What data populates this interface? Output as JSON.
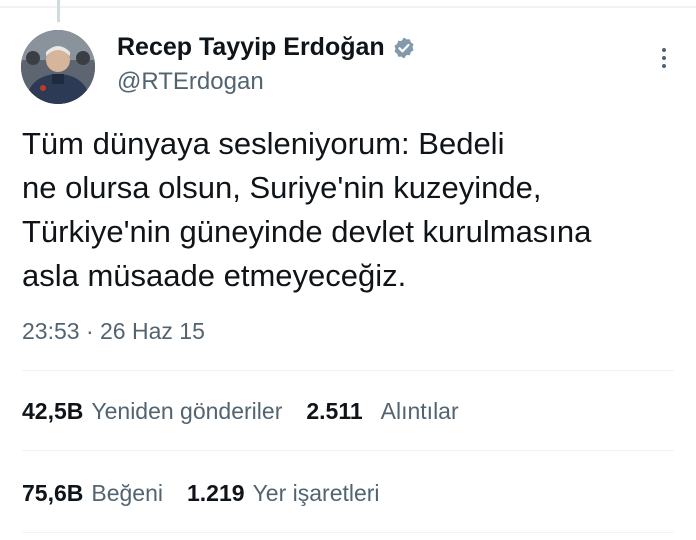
{
  "author": {
    "name": "Recep Tayyip Erdoğan",
    "handle": "@RTErdogan",
    "verified_badge_color": "#829aab"
  },
  "tweet": {
    "text": "Tüm dünyaya sesleniyorum: Bedeli\nne olursa olsun, Suriye'nin kuzeyinde,\nTürkiye'nin güneyinde devlet kurulmasına\nasla müsaade etmeyeceğiz.",
    "time": "23:53",
    "separator": "·",
    "date": "26 Haz 15"
  },
  "stats": {
    "reposts_count": "42,5B",
    "reposts_label": "Yeniden gönderiler",
    "quotes_count": "2.511",
    "quotes_label": "Alıntılar",
    "likes_count": "75,6B",
    "likes_label": "Beğeni",
    "bookmarks_count": "1.219",
    "bookmarks_label": "Yer işaretleri"
  },
  "icons": {
    "more": "more-vertical-icon",
    "verified": "verified-badge-icon"
  }
}
